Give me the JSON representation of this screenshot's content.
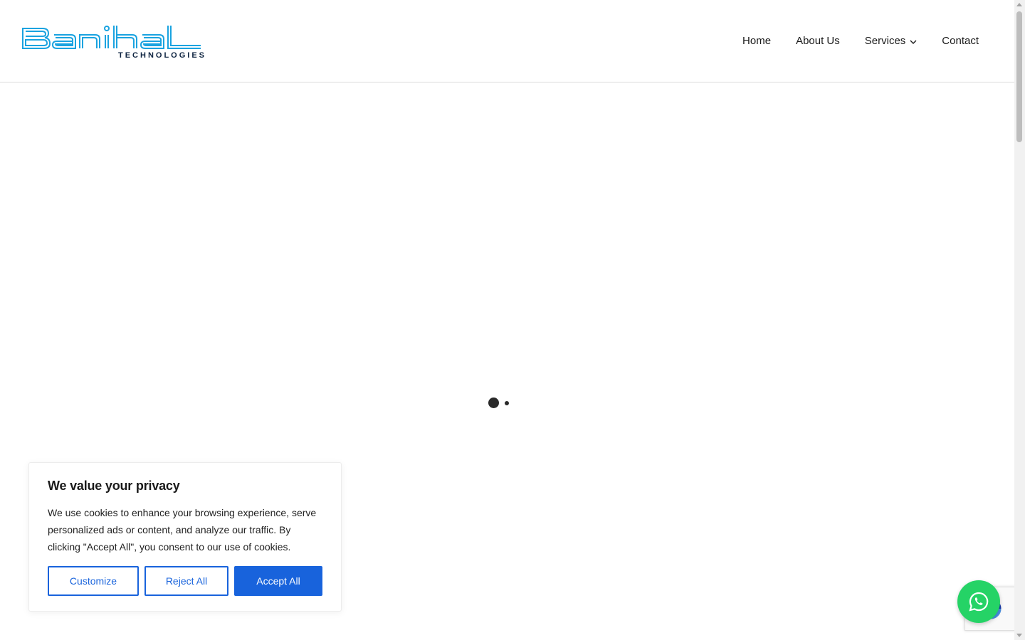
{
  "logo": {
    "brand": "Banihal",
    "tagline": "TECHNOLOGIES",
    "icon": "banihal-logo",
    "color": "#1aa3e0"
  },
  "nav": {
    "items": [
      {
        "label": "Home"
      },
      {
        "label": "About Us"
      },
      {
        "label": "Services",
        "icon": "chevron-down-icon"
      },
      {
        "label": "Contact"
      }
    ]
  },
  "loader": {
    "icon": "loading-dots"
  },
  "cookie": {
    "title": "We value your privacy",
    "text": "We use cookies to enhance your browsing experience, serve personalized ads or content, and analyze our traffic. By clicking \"Accept All\", you consent to our use of cookies.",
    "customize_label": "Customize",
    "reject_label": "Reject All",
    "accept_label": "Accept All",
    "accent_color": "#1863dc"
  },
  "whatsapp": {
    "icon": "whatsapp-icon",
    "color": "#25d366"
  },
  "recaptcha": {
    "icon": "recaptcha-icon"
  }
}
